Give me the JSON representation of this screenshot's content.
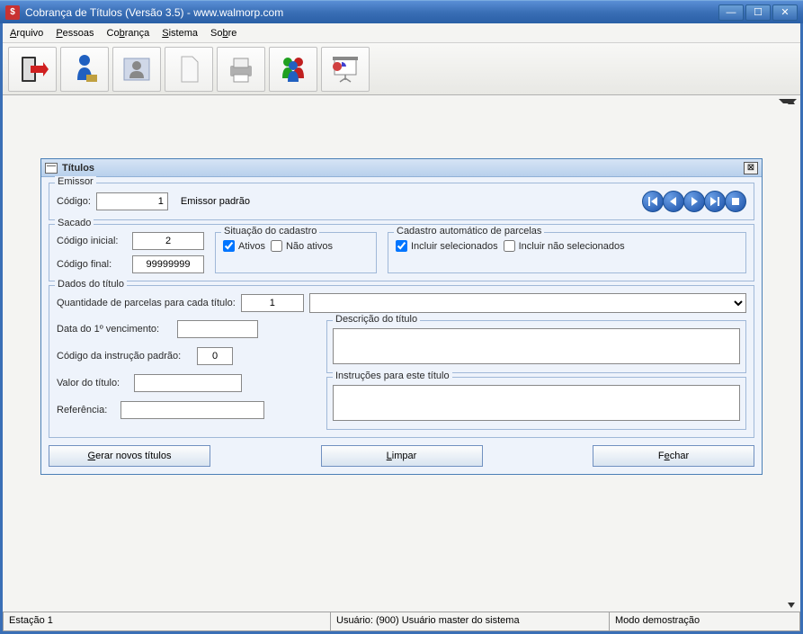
{
  "window": {
    "title": "Cobrança de Títulos (Versão 3.5) - www.walmorp.com",
    "app_icon_char": "$"
  },
  "menu": {
    "arquivo": "Arquivo",
    "pessoas": "Pessoas",
    "cobranca": "Cobrança",
    "sistema": "Sistema",
    "sobre": "Sobre"
  },
  "panel": {
    "title": "Títulos"
  },
  "emissor": {
    "legend": "Emissor",
    "codigo_label": "Código:",
    "codigo_value": "1",
    "nome": "Emissor padrão"
  },
  "sacado": {
    "legend": "Sacado",
    "codigo_inicial_label": "Código inicial:",
    "codigo_inicial_value": "2",
    "codigo_final_label": "Código final:",
    "codigo_final_value": "99999999",
    "situacao_legend": "Situação do cadastro",
    "ativos_label": "Ativos",
    "ativos_checked": true,
    "nao_ativos_label": "Não ativos",
    "nao_ativos_checked": false,
    "cadastro_legend": "Cadastro automático de parcelas",
    "incluir_sel_label": "Incluir selecionados",
    "incluir_sel_checked": true,
    "incluir_nao_sel_label": "Incluir não selecionados",
    "incluir_nao_sel_checked": false
  },
  "dados": {
    "legend": "Dados do título",
    "qtd_label": "Quantidade de parcelas para cada título:",
    "qtd_value": "1",
    "data_venc_label": "Data do 1º vencimento:",
    "data_venc_value": "",
    "instrucao_label": "Código da instrução padrão:",
    "instrucao_value": "0",
    "valor_label": "Valor do título:",
    "valor_value": "",
    "ref_label": "Referência:",
    "ref_value": "",
    "descricao_legend": "Descrição do título",
    "descricao_value": "",
    "instrucoes_legend": "Instruções para este título",
    "instrucoes_value": ""
  },
  "buttons": {
    "gerar": "Gerar novos títulos",
    "limpar": "Limpar",
    "fechar": "Fechar"
  },
  "status": {
    "estacao": "Estação 1",
    "usuario": "Usuário: (900) Usuário master do sistema",
    "modo": "Modo demostração"
  }
}
